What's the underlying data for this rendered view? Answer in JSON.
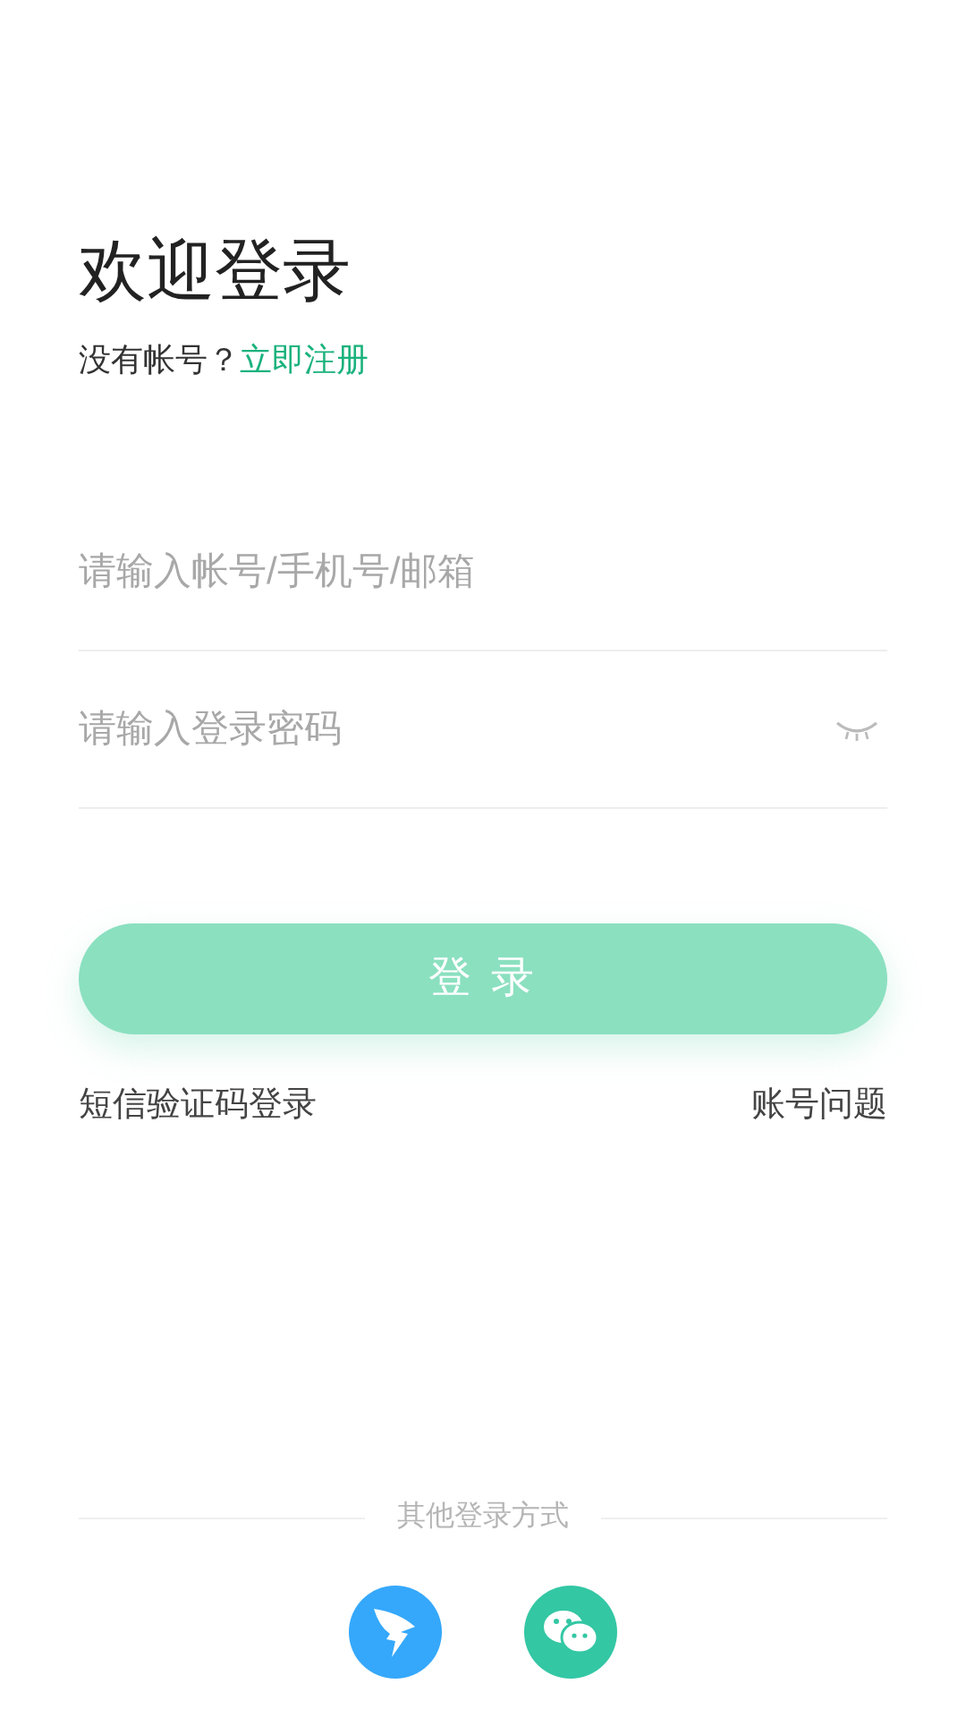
{
  "title": "欢迎登录",
  "register_prompt": {
    "text": "没有帐号？",
    "link": "立即注册"
  },
  "fields": [
    {
      "kind": "text",
      "placeholder": "请输入帐号/手机号/邮箱"
    },
    {
      "kind": "password",
      "placeholder": "请输入登录密码",
      "password_visible": false
    }
  ],
  "login_button": {
    "label": "登 录",
    "disabled": true
  },
  "links": [
    "短信验证码登录",
    "账号问题"
  ],
  "other_login": {
    "label": "其他登录方式",
    "providers": [
      {
        "kind": "wing",
        "color": "#35a8fb"
      },
      {
        "kind": "chat",
        "color": "#33c7a4"
      }
    ]
  }
}
